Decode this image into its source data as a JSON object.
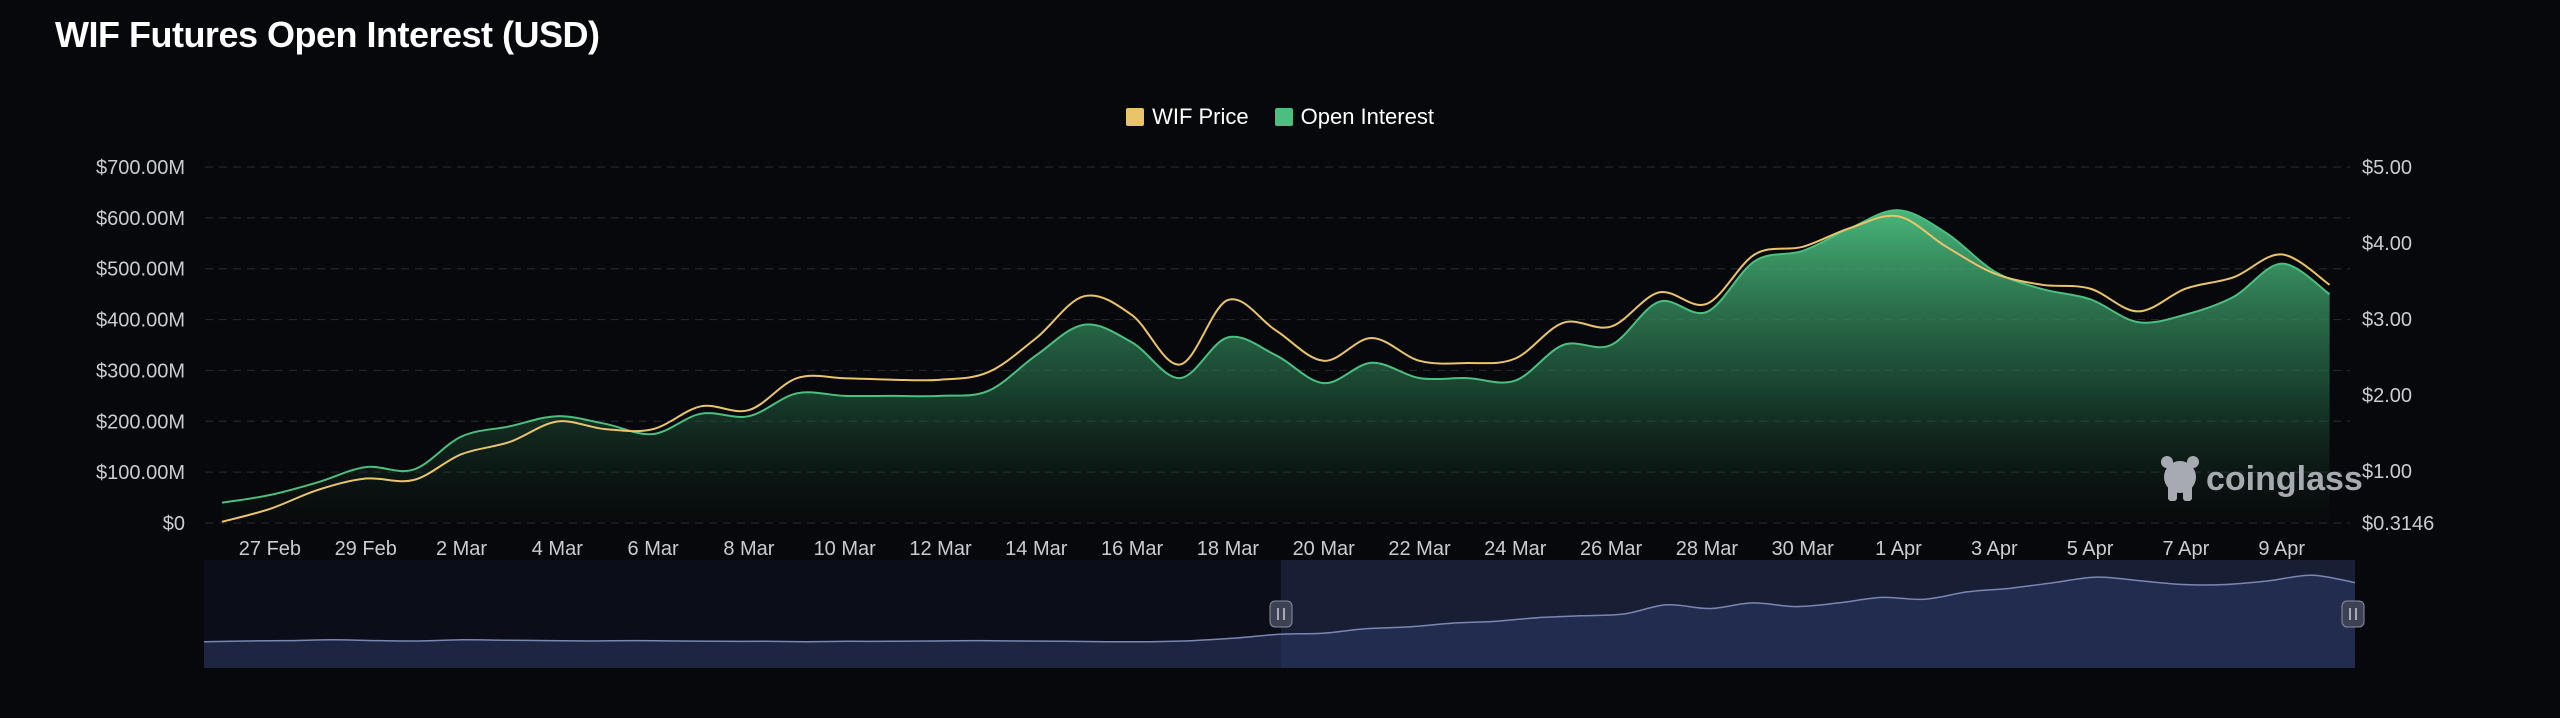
{
  "title": "WIF Futures Open Interest (USD)",
  "watermark": "coinglass",
  "colors": {
    "price": "#e9c46a",
    "oi": "#4cbf80",
    "background": "#07080b",
    "navigator_fill": "#1e2742",
    "navigator_line": "#7b86b3"
  },
  "legend": [
    {
      "label": "WIF Price",
      "color": "#e9c46a"
    },
    {
      "label": "Open Interest",
      "color": "#4cbf80"
    }
  ],
  "chart_data": {
    "type": "area",
    "title": "WIF Futures Open Interest (USD)",
    "x_ticks": [
      "27 Feb",
      "29 Feb",
      "2 Mar",
      "4 Mar",
      "6 Mar",
      "8 Mar",
      "10 Mar",
      "12 Mar",
      "14 Mar",
      "16 Mar",
      "18 Mar",
      "20 Mar",
      "22 Mar",
      "24 Mar",
      "26 Mar",
      "28 Mar",
      "30 Mar",
      "1 Apr",
      "3 Apr",
      "5 Apr",
      "7 Apr",
      "9 Apr"
    ],
    "y_left_ticks": [
      "$0",
      "$100.00M",
      "$200.00M",
      "$300.00M",
      "$400.00M",
      "$500.00M",
      "$600.00M",
      "$700.00M"
    ],
    "y_left_range": [
      0,
      700
    ],
    "y_right_ticks": [
      "$0.3146",
      "$1.00",
      "$2.00",
      "$3.00",
      "$4.00",
      "$5.00"
    ],
    "y_right_range": [
      0.3146,
      5.0
    ],
    "grid": true,
    "legend_position": "top-center",
    "series": [
      {
        "name": "Open Interest",
        "axis": "left",
        "unit": "USD millions",
        "x": [
          "26 Feb",
          "27 Feb",
          "28 Feb",
          "29 Feb",
          "1 Mar",
          "2 Mar",
          "3 Mar",
          "4 Mar",
          "5 Mar",
          "6 Mar",
          "7 Mar",
          "8 Mar",
          "9 Mar",
          "10 Mar",
          "11 Mar",
          "12 Mar",
          "13 Mar",
          "14 Mar",
          "15 Mar",
          "16 Mar",
          "17 Mar",
          "18 Mar",
          "19 Mar",
          "20 Mar",
          "21 Mar",
          "22 Mar",
          "23 Mar",
          "24 Mar",
          "25 Mar",
          "26 Mar",
          "27 Mar",
          "28 Mar",
          "29 Mar",
          "30 Mar",
          "31 Mar",
          "1 Apr",
          "2 Apr",
          "3 Apr",
          "4 Apr",
          "5 Apr",
          "6 Apr",
          "7 Apr",
          "8 Apr",
          "9 Apr",
          "10 Apr"
        ],
        "values": [
          40,
          55,
          80,
          110,
          105,
          170,
          190,
          210,
          195,
          175,
          215,
          210,
          255,
          250,
          250,
          250,
          260,
          330,
          390,
          355,
          285,
          365,
          330,
          275,
          315,
          285,
          285,
          280,
          350,
          350,
          435,
          415,
          515,
          535,
          580,
          615,
          570,
          495,
          460,
          440,
          395,
          410,
          445,
          510,
          450
        ]
      },
      {
        "name": "WIF Price",
        "axis": "right",
        "unit": "USD",
        "x": [
          "26 Feb",
          "27 Feb",
          "28 Feb",
          "29 Feb",
          "1 Mar",
          "2 Mar",
          "3 Mar",
          "4 Mar",
          "5 Mar",
          "6 Mar",
          "7 Mar",
          "8 Mar",
          "9 Mar",
          "10 Mar",
          "11 Mar",
          "12 Mar",
          "13 Mar",
          "14 Mar",
          "15 Mar",
          "16 Mar",
          "17 Mar",
          "18 Mar",
          "19 Mar",
          "20 Mar",
          "21 Mar",
          "22 Mar",
          "23 Mar",
          "24 Mar",
          "25 Mar",
          "26 Mar",
          "27 Mar",
          "28 Mar",
          "29 Mar",
          "30 Mar",
          "31 Mar",
          "1 Apr",
          "2 Apr",
          "3 Apr",
          "4 Apr",
          "5 Apr",
          "6 Apr",
          "7 Apr",
          "8 Apr",
          "9 Apr",
          "10 Apr"
        ],
        "values": [
          0.33,
          0.5,
          0.75,
          0.9,
          0.88,
          1.22,
          1.38,
          1.65,
          1.55,
          1.55,
          1.85,
          1.8,
          2.22,
          2.22,
          2.2,
          2.2,
          2.3,
          2.75,
          3.3,
          3.05,
          2.4,
          3.25,
          2.85,
          2.45,
          2.75,
          2.45,
          2.42,
          2.48,
          2.95,
          2.9,
          3.35,
          3.2,
          3.85,
          3.95,
          4.2,
          4.35,
          3.95,
          3.6,
          3.45,
          3.4,
          3.1,
          3.4,
          3.55,
          3.85,
          3.45
        ]
      }
    ],
    "navigator": {
      "values": [
        0.55,
        0.57,
        0.58,
        0.6,
        0.58,
        0.57,
        0.6,
        0.59,
        0.58,
        0.57,
        0.58,
        0.57,
        0.56,
        0.56,
        0.55,
        0.56,
        0.56,
        0.57,
        0.58,
        0.57,
        0.56,
        0.55,
        0.55,
        0.58,
        0.65,
        0.75,
        0.78,
        0.9,
        0.95,
        1.05,
        1.1,
        1.2,
        1.25,
        1.3,
        1.55,
        1.45,
        1.6,
        1.5,
        1.6,
        1.75,
        1.7,
        1.9,
        2.0,
        2.15,
        2.3,
        2.2,
        2.1,
        2.1,
        2.2,
        2.35,
        2.15
      ]
    }
  }
}
